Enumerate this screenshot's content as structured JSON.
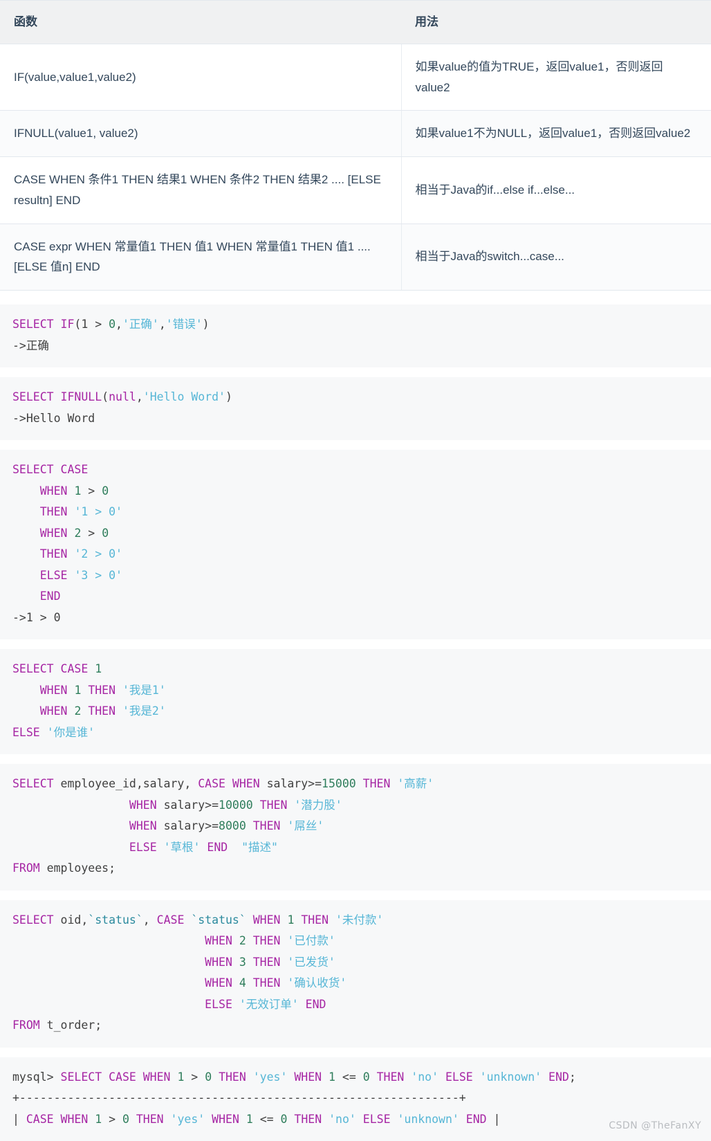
{
  "table": {
    "headers": [
      "函数",
      "用法"
    ],
    "rows": [
      {
        "func": "IF(value,value1,value2)",
        "usage": "如果value的值为TRUE，返回value1，否则返回value2"
      },
      {
        "func": "IFNULL(value1, value2)",
        "usage": "如果value1不为NULL，返回value1，否则返回value2"
      },
      {
        "func": "CASE WHEN 条件1 THEN 结果1 WHEN 条件2 THEN 结果2 .... [ELSE resultn] END",
        "usage": "相当于Java的if...else if...else..."
      },
      {
        "func": "CASE expr WHEN 常量值1 THEN 值1 WHEN 常量值1 THEN 值1 .... [ELSE 值n] END",
        "usage": "相当于Java的switch...case..."
      }
    ]
  },
  "code_blocks": [
    {
      "id": "if-example",
      "lines": [
        [
          {
            "t": "SELECT ",
            "c": "kw"
          },
          {
            "t": "IF",
            "c": "kw"
          },
          {
            "t": "(",
            "c": "plain"
          },
          {
            "t": "1",
            "c": "plain"
          },
          {
            "t": " > ",
            "c": "plain"
          },
          {
            "t": "0",
            "c": "num"
          },
          {
            "t": ",",
            "c": "plain"
          },
          {
            "t": "'正确'",
            "c": "str"
          },
          {
            "t": ",",
            "c": "plain"
          },
          {
            "t": "'错误'",
            "c": "str"
          },
          {
            "t": ")",
            "c": "plain"
          }
        ],
        [
          {
            "t": "->正确",
            "c": "plain"
          }
        ]
      ]
    },
    {
      "id": "ifnull-example",
      "lines": [
        [
          {
            "t": "SELECT ",
            "c": "kw"
          },
          {
            "t": "IFNULL",
            "c": "kw"
          },
          {
            "t": "(",
            "c": "plain"
          },
          {
            "t": "null",
            "c": "kw"
          },
          {
            "t": ",",
            "c": "plain"
          },
          {
            "t": "'Hello Word'",
            "c": "str"
          },
          {
            "t": ")",
            "c": "plain"
          }
        ],
        [
          {
            "t": "->Hello Word",
            "c": "plain"
          }
        ]
      ]
    },
    {
      "id": "case-when-example",
      "lines": [
        [
          {
            "t": "SELECT CASE",
            "c": "kw"
          }
        ],
        [
          {
            "t": "    ",
            "c": "plain"
          },
          {
            "t": "WHEN",
            "c": "kw"
          },
          {
            "t": " ",
            "c": "plain"
          },
          {
            "t": "1",
            "c": "num"
          },
          {
            "t": " > ",
            "c": "plain"
          },
          {
            "t": "0",
            "c": "num"
          }
        ],
        [
          {
            "t": "    ",
            "c": "plain"
          },
          {
            "t": "THEN",
            "c": "kw"
          },
          {
            "t": " ",
            "c": "plain"
          },
          {
            "t": "'1 > 0'",
            "c": "str"
          }
        ],
        [
          {
            "t": "    ",
            "c": "plain"
          },
          {
            "t": "WHEN",
            "c": "kw"
          },
          {
            "t": " ",
            "c": "plain"
          },
          {
            "t": "2",
            "c": "num"
          },
          {
            "t": " > ",
            "c": "plain"
          },
          {
            "t": "0",
            "c": "num"
          }
        ],
        [
          {
            "t": "    ",
            "c": "plain"
          },
          {
            "t": "THEN",
            "c": "kw"
          },
          {
            "t": " ",
            "c": "plain"
          },
          {
            "t": "'2 > 0'",
            "c": "str"
          }
        ],
        [
          {
            "t": "    ",
            "c": "plain"
          },
          {
            "t": "ELSE",
            "c": "kw"
          },
          {
            "t": " ",
            "c": "plain"
          },
          {
            "t": "'3 > 0'",
            "c": "str"
          }
        ],
        [
          {
            "t": "    ",
            "c": "plain"
          },
          {
            "t": "END",
            "c": "kw"
          }
        ],
        [
          {
            "t": "->1 > 0",
            "c": "plain"
          }
        ]
      ]
    },
    {
      "id": "case-value-example",
      "lines": [
        [
          {
            "t": "SELECT CASE",
            "c": "kw"
          },
          {
            "t": " ",
            "c": "plain"
          },
          {
            "t": "1",
            "c": "num"
          }
        ],
        [
          {
            "t": "    ",
            "c": "plain"
          },
          {
            "t": "WHEN",
            "c": "kw"
          },
          {
            "t": " ",
            "c": "plain"
          },
          {
            "t": "1",
            "c": "num"
          },
          {
            "t": " ",
            "c": "plain"
          },
          {
            "t": "THEN",
            "c": "kw"
          },
          {
            "t": " ",
            "c": "plain"
          },
          {
            "t": "'我是1'",
            "c": "str"
          }
        ],
        [
          {
            "t": "    ",
            "c": "plain"
          },
          {
            "t": "WHEN",
            "c": "kw"
          },
          {
            "t": " ",
            "c": "plain"
          },
          {
            "t": "2",
            "c": "num"
          },
          {
            "t": " ",
            "c": "plain"
          },
          {
            "t": "THEN",
            "c": "kw"
          },
          {
            "t": " ",
            "c": "plain"
          },
          {
            "t": "'我是2'",
            "c": "str"
          }
        ],
        [
          {
            "t": "ELSE",
            "c": "kw"
          },
          {
            "t": " ",
            "c": "plain"
          },
          {
            "t": "'你是谁'",
            "c": "str"
          }
        ]
      ]
    },
    {
      "id": "employees-example",
      "lines": [
        [
          {
            "t": "SELECT",
            "c": "kw"
          },
          {
            "t": " employee_id,salary, ",
            "c": "plain"
          },
          {
            "t": "CASE WHEN",
            "c": "kw"
          },
          {
            "t": " salary>=",
            "c": "plain"
          },
          {
            "t": "15000",
            "c": "num"
          },
          {
            "t": " ",
            "c": "plain"
          },
          {
            "t": "THEN",
            "c": "kw"
          },
          {
            "t": " ",
            "c": "plain"
          },
          {
            "t": "'高薪'",
            "c": "str"
          }
        ],
        [
          {
            "t": "                 ",
            "c": "plain"
          },
          {
            "t": "WHEN",
            "c": "kw"
          },
          {
            "t": " salary>=",
            "c": "plain"
          },
          {
            "t": "10000",
            "c": "num"
          },
          {
            "t": " ",
            "c": "plain"
          },
          {
            "t": "THEN",
            "c": "kw"
          },
          {
            "t": " ",
            "c": "plain"
          },
          {
            "t": "'潜力股'",
            "c": "str"
          }
        ],
        [
          {
            "t": "                 ",
            "c": "plain"
          },
          {
            "t": "WHEN",
            "c": "kw"
          },
          {
            "t": " salary>=",
            "c": "plain"
          },
          {
            "t": "8000",
            "c": "num"
          },
          {
            "t": " ",
            "c": "plain"
          },
          {
            "t": "THEN",
            "c": "kw"
          },
          {
            "t": " ",
            "c": "plain"
          },
          {
            "t": "'屌丝'",
            "c": "str"
          }
        ],
        [
          {
            "t": "                 ",
            "c": "plain"
          },
          {
            "t": "ELSE",
            "c": "kw"
          },
          {
            "t": " ",
            "c": "plain"
          },
          {
            "t": "'草根'",
            "c": "str"
          },
          {
            "t": " ",
            "c": "plain"
          },
          {
            "t": "END",
            "c": "kw"
          },
          {
            "t": "  ",
            "c": "plain"
          },
          {
            "t": "\"描述\"",
            "c": "str"
          }
        ],
        [
          {
            "t": "FROM",
            "c": "kw"
          },
          {
            "t": " employees;",
            "c": "plain"
          }
        ]
      ]
    },
    {
      "id": "t-order-example",
      "lines": [
        [
          {
            "t": "SELECT",
            "c": "kw"
          },
          {
            "t": " oid,",
            "c": "plain"
          },
          {
            "t": "`status`",
            "c": "tick"
          },
          {
            "t": ", ",
            "c": "plain"
          },
          {
            "t": "CASE",
            "c": "kw"
          },
          {
            "t": " ",
            "c": "plain"
          },
          {
            "t": "`status`",
            "c": "tick"
          },
          {
            "t": " ",
            "c": "plain"
          },
          {
            "t": "WHEN",
            "c": "kw"
          },
          {
            "t": " ",
            "c": "plain"
          },
          {
            "t": "1",
            "c": "num"
          },
          {
            "t": " ",
            "c": "plain"
          },
          {
            "t": "THEN",
            "c": "kw"
          },
          {
            "t": " ",
            "c": "plain"
          },
          {
            "t": "'未付款'",
            "c": "str"
          }
        ],
        [
          {
            "t": "                            ",
            "c": "plain"
          },
          {
            "t": "WHEN",
            "c": "kw"
          },
          {
            "t": " ",
            "c": "plain"
          },
          {
            "t": "2",
            "c": "num"
          },
          {
            "t": " ",
            "c": "plain"
          },
          {
            "t": "THEN",
            "c": "kw"
          },
          {
            "t": " ",
            "c": "plain"
          },
          {
            "t": "'已付款'",
            "c": "str"
          }
        ],
        [
          {
            "t": "                            ",
            "c": "plain"
          },
          {
            "t": "WHEN",
            "c": "kw"
          },
          {
            "t": " ",
            "c": "plain"
          },
          {
            "t": "3",
            "c": "num"
          },
          {
            "t": " ",
            "c": "plain"
          },
          {
            "t": "THEN",
            "c": "kw"
          },
          {
            "t": " ",
            "c": "plain"
          },
          {
            "t": "'已发货'",
            "c": "str"
          }
        ],
        [
          {
            "t": "                            ",
            "c": "plain"
          },
          {
            "t": "WHEN",
            "c": "kw"
          },
          {
            "t": " ",
            "c": "plain"
          },
          {
            "t": "4",
            "c": "num"
          },
          {
            "t": " ",
            "c": "plain"
          },
          {
            "t": "THEN",
            "c": "kw"
          },
          {
            "t": " ",
            "c": "plain"
          },
          {
            "t": "'确认收货'",
            "c": "str"
          }
        ],
        [
          {
            "t": "                            ",
            "c": "plain"
          },
          {
            "t": "ELSE",
            "c": "kw"
          },
          {
            "t": " ",
            "c": "plain"
          },
          {
            "t": "'无效订单'",
            "c": "str"
          },
          {
            "t": " ",
            "c": "plain"
          },
          {
            "t": "END",
            "c": "kw"
          }
        ],
        [
          {
            "t": "FROM",
            "c": "kw"
          },
          {
            "t": " t_order;",
            "c": "plain"
          }
        ]
      ]
    },
    {
      "id": "mysql-terminal-example",
      "lines": [
        [
          {
            "t": "mysql> ",
            "c": "plain"
          },
          {
            "t": "SELECT CASE WHEN",
            "c": "kw"
          },
          {
            "t": " ",
            "c": "plain"
          },
          {
            "t": "1",
            "c": "num"
          },
          {
            "t": " > ",
            "c": "plain"
          },
          {
            "t": "0",
            "c": "num"
          },
          {
            "t": " ",
            "c": "plain"
          },
          {
            "t": "THEN",
            "c": "kw"
          },
          {
            "t": " ",
            "c": "plain"
          },
          {
            "t": "'yes'",
            "c": "str"
          },
          {
            "t": " ",
            "c": "plain"
          },
          {
            "t": "WHEN",
            "c": "kw"
          },
          {
            "t": " ",
            "c": "plain"
          },
          {
            "t": "1",
            "c": "num"
          },
          {
            "t": " <= ",
            "c": "plain"
          },
          {
            "t": "0",
            "c": "num"
          },
          {
            "t": " ",
            "c": "plain"
          },
          {
            "t": "THEN",
            "c": "kw"
          },
          {
            "t": " ",
            "c": "plain"
          },
          {
            "t": "'no'",
            "c": "str"
          },
          {
            "t": " ",
            "c": "plain"
          },
          {
            "t": "ELSE",
            "c": "kw"
          },
          {
            "t": " ",
            "c": "plain"
          },
          {
            "t": "'unknown'",
            "c": "str"
          },
          {
            "t": " ",
            "c": "plain"
          },
          {
            "t": "END",
            "c": "kw"
          },
          {
            "t": ";",
            "c": "plain"
          }
        ],
        [
          {
            "t": "+----------------------------------------------------------------+",
            "c": "plain"
          }
        ],
        [
          {
            "t": "| ",
            "c": "plain"
          },
          {
            "t": "CASE WHEN",
            "c": "kw"
          },
          {
            "t": " ",
            "c": "plain"
          },
          {
            "t": "1",
            "c": "num"
          },
          {
            "t": " > ",
            "c": "plain"
          },
          {
            "t": "0",
            "c": "num"
          },
          {
            "t": " ",
            "c": "plain"
          },
          {
            "t": "THEN",
            "c": "kw"
          },
          {
            "t": " ",
            "c": "plain"
          },
          {
            "t": "'yes'",
            "c": "str"
          },
          {
            "t": " ",
            "c": "plain"
          },
          {
            "t": "WHEN",
            "c": "kw"
          },
          {
            "t": " ",
            "c": "plain"
          },
          {
            "t": "1",
            "c": "num"
          },
          {
            "t": " <= ",
            "c": "plain"
          },
          {
            "t": "0",
            "c": "num"
          },
          {
            "t": " ",
            "c": "plain"
          },
          {
            "t": "THEN",
            "c": "kw"
          },
          {
            "t": " ",
            "c": "plain"
          },
          {
            "t": "'no'",
            "c": "str"
          },
          {
            "t": " ",
            "c": "plain"
          },
          {
            "t": "ELSE",
            "c": "kw"
          },
          {
            "t": " ",
            "c": "plain"
          },
          {
            "t": "'unknown'",
            "c": "str"
          },
          {
            "t": " ",
            "c": "plain"
          },
          {
            "t": "END",
            "c": "kw"
          },
          {
            "t": " |",
            "c": "plain"
          }
        ]
      ]
    }
  ],
  "watermark": "CSDN @TheFanXY",
  "colors": {
    "header_bg": "#f0f1f2",
    "header_text": "#33475b",
    "code_bg": "#f7f8f9",
    "keyword": "#a626a4",
    "string": "#56b6d6",
    "number": "#2e7d5b",
    "plain": "#404040",
    "border": "#e3e8ee"
  }
}
